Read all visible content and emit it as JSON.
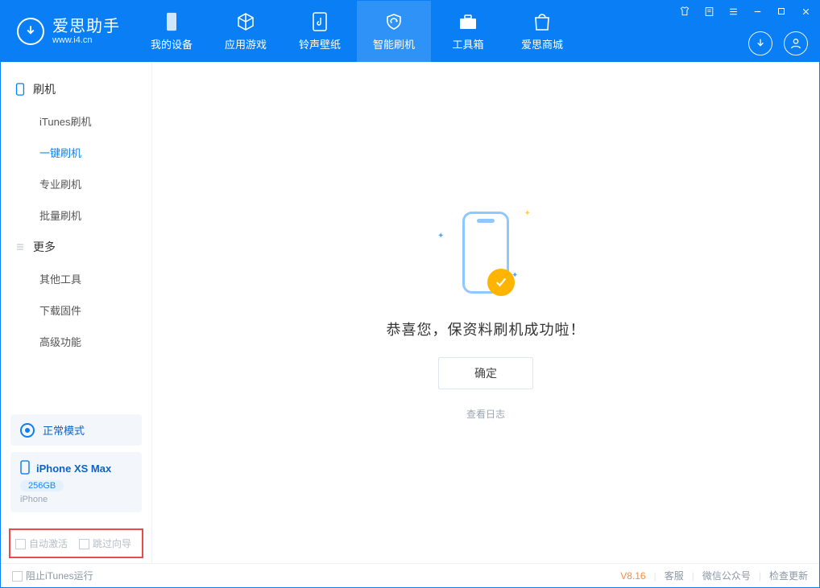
{
  "brand": {
    "title": "爱思助手",
    "subtitle": "www.i4.cn"
  },
  "tabs": [
    {
      "label": "我的设备"
    },
    {
      "label": "应用游戏"
    },
    {
      "label": "铃声壁纸"
    },
    {
      "label": "智能刷机"
    },
    {
      "label": "工具箱"
    },
    {
      "label": "爱思商城"
    }
  ],
  "sidebar": {
    "section_flash": "刷机",
    "items_flash": [
      {
        "label": "iTunes刷机"
      },
      {
        "label": "一键刷机"
      },
      {
        "label": "专业刷机"
      },
      {
        "label": "批量刷机"
      }
    ],
    "section_more": "更多",
    "items_more": [
      {
        "label": "其他工具"
      },
      {
        "label": "下载固件"
      },
      {
        "label": "高级功能"
      }
    ]
  },
  "device": {
    "mode_label": "正常模式",
    "model": "iPhone XS Max",
    "capacity": "256GB",
    "type": "iPhone"
  },
  "options": {
    "auto_activate": "自动激活",
    "skip_guide": "跳过向导"
  },
  "main": {
    "success_text": "恭喜您，保资料刷机成功啦！",
    "ok_button": "确定",
    "view_log": "查看日志"
  },
  "statusbar": {
    "block_itunes": "阻止iTunes运行",
    "version": "V8.16",
    "link_service": "客服",
    "link_wechat": "微信公众号",
    "link_update": "检查更新"
  }
}
